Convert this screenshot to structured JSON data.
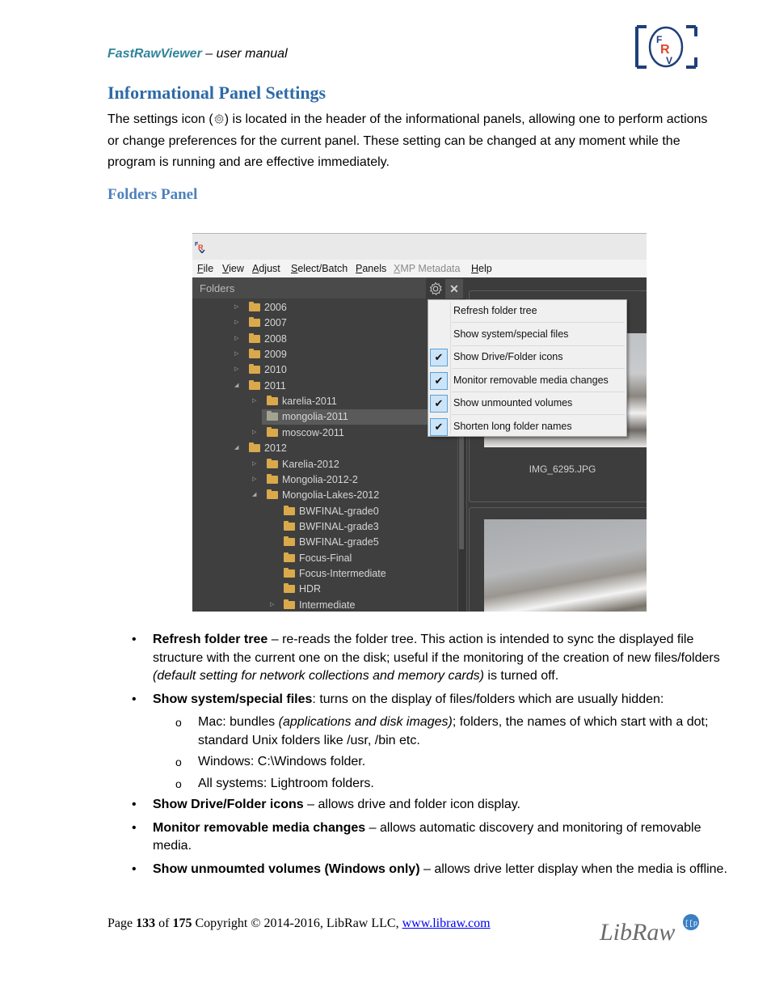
{
  "header": {
    "brand": "FastRawViewer",
    "subtitle": " – user manual",
    "logo_letters": [
      "F",
      "R",
      "V"
    ]
  },
  "section": {
    "title": "Informational Panel Settings",
    "intro_before_icon": "The settings icon (",
    "intro_after_icon": ") is located in the header of the informational panels, allowing one to perform actions or change preferences for the current panel. These setting can be changed at any moment while the program is running and are effective immediately.",
    "subsection_title": "Folders Panel"
  },
  "app": {
    "menu": [
      {
        "label": "File",
        "underline": "F",
        "rest": "ile",
        "disabled": false
      },
      {
        "label": "View",
        "underline": "V",
        "rest": "iew",
        "disabled": false
      },
      {
        "label": "Adjust",
        "underline": "A",
        "rest": "djust",
        "disabled": false
      },
      {
        "label": "Select/Batch",
        "underline": "S",
        "rest": "elect/Batch",
        "disabled": false
      },
      {
        "label": "Panels",
        "underline": "P",
        "rest": "anels",
        "disabled": false
      },
      {
        "label": "XMP Metadata",
        "underline": "X",
        "rest": "MP Metadata",
        "disabled": true
      },
      {
        "label": "Help",
        "underline": "H",
        "rest": "elp",
        "disabled": false
      }
    ],
    "panel_title": "Folders",
    "close_glyph": "✕",
    "tree": [
      {
        "name": "2006",
        "level": 0,
        "arrow": "collapsed"
      },
      {
        "name": "2007",
        "level": 0,
        "arrow": "collapsed"
      },
      {
        "name": "2008",
        "level": 0,
        "arrow": "collapsed"
      },
      {
        "name": "2009",
        "level": 0,
        "arrow": "collapsed"
      },
      {
        "name": "2010",
        "level": 0,
        "arrow": "collapsed"
      },
      {
        "name": "2011",
        "level": 0,
        "arrow": "expanded"
      },
      {
        "name": "karelia-2011",
        "level": 1,
        "arrow": "collapsed"
      },
      {
        "name": "mongolia-2011",
        "level": 1,
        "arrow": "none",
        "selected": true
      },
      {
        "name": "moscow-2011",
        "level": 1,
        "arrow": "collapsed"
      },
      {
        "name": "2012",
        "level": 0,
        "arrow": "expanded"
      },
      {
        "name": "Karelia-2012",
        "level": 1,
        "arrow": "collapsed"
      },
      {
        "name": "Mongolia-2012-2",
        "level": 1,
        "arrow": "collapsed"
      },
      {
        "name": "Mongolia-Lakes-2012",
        "level": 1,
        "arrow": "expanded"
      },
      {
        "name": "BWFINAL-grade0",
        "level": 2,
        "arrow": "none"
      },
      {
        "name": "BWFINAL-grade3",
        "level": 2,
        "arrow": "none"
      },
      {
        "name": "BWFINAL-grade5",
        "level": 2,
        "arrow": "none"
      },
      {
        "name": "Focus-Final",
        "level": 2,
        "arrow": "none"
      },
      {
        "name": "Focus-Intermediate",
        "level": 2,
        "arrow": "none"
      },
      {
        "name": "HDR",
        "level": 2,
        "arrow": "none"
      },
      {
        "name": "Intermediate",
        "level": 2,
        "arrow": "collapsed"
      }
    ],
    "context_menu": [
      {
        "label": "Refresh folder tree",
        "checked": false
      },
      {
        "label": "Show system/special files",
        "checked": false
      },
      {
        "label": "Show Drive/Folder icons",
        "checked": true
      },
      {
        "label": "Monitor removable media changes",
        "checked": true
      },
      {
        "label": "Show unmounted volumes",
        "checked": true
      },
      {
        "label": "Shorten long folder names",
        "checked": true
      }
    ],
    "check_glyph": "✔",
    "thumbnail_label": "IMG_6295.JPG"
  },
  "bullets": [
    {
      "term": "Refresh folder tree",
      "sep": " – ",
      "text_before": "re-reads the folder tree. This action is intended to sync the displayed file structure with the current one on the disk; useful if the monitoring of the creation of new files/folders ",
      "italic": "(default setting for network collections and memory cards)",
      "text_after": " is turned off."
    },
    {
      "term": "Show system/special files",
      "sep": ": ",
      "text_before": "turns on the display of files/folders which are usually hidden:",
      "sub": [
        {
          "before": "Mac: bundles ",
          "italic": "(applications and disk images)",
          "after": "; folders, the names of which start with a dot; standard Unix folders like /usr, /bin etc."
        },
        {
          "before": "Windows: C:\\Windows folder.",
          "italic": "",
          "after": ""
        },
        {
          "before": "All systems: Lightroom folders.",
          "italic": "",
          "after": ""
        }
      ]
    },
    {
      "term": "Show Drive/Folder icons",
      "sep": " – ",
      "text_before": "allows drive and folder icon display."
    },
    {
      "term": "Monitor removable media changes",
      "sep": " – ",
      "text_before": "allows automatic discovery and monitoring of removable media."
    },
    {
      "term": "Show unmoumted volumes (Windows only)",
      "sep": " – ",
      "text_before": "allows drive letter display when the media is offline."
    }
  ],
  "footer": {
    "page_label": "Page ",
    "page_num": "133",
    "of_label": " of ",
    "page_total": "175",
    "copyright": " Copyright © 2014-2016, LibRaw LLC, ",
    "link": "www.libraw.com",
    "logo_text": "LibRaw"
  },
  "colors": {
    "brand": "#31849b",
    "heading": "#2e6aa6",
    "subheading": "#4f81bd",
    "check_bg": "#cce4f7",
    "check_border": "#5ba2d8"
  }
}
